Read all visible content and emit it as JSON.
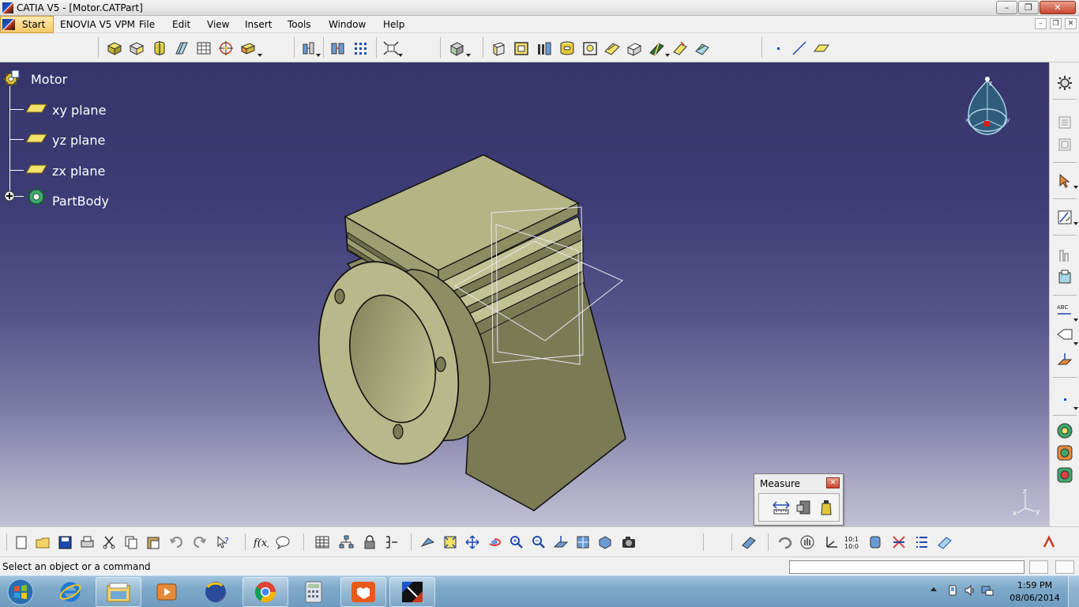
{
  "window": {
    "title": "CATIA V5 - [Motor.CATPart]",
    "controls": {
      "minimize": "–",
      "restore": "❒",
      "close": "✕"
    }
  },
  "menubar": {
    "start": "Start",
    "items": [
      "ENOVIA V5 VPM",
      "File",
      "Edit",
      "View",
      "Insert",
      "Tools",
      "Window",
      "Help"
    ],
    "mdi_controls": [
      "–",
      "❒",
      "✕"
    ]
  },
  "tree": {
    "root": "Motor",
    "children": [
      "xy plane",
      "yz plane",
      "zx plane",
      "PartBody"
    ]
  },
  "measure_window": {
    "title": "Measure",
    "tools": [
      "measure-between-icon",
      "measure-item-icon",
      "measure-inertia-icon"
    ]
  },
  "compass_axes": {
    "z": "z",
    "x": "x",
    "y": "y"
  },
  "statusbar": {
    "text": "Select an object or a command",
    "command_input": ""
  },
  "taskbar": {
    "time": "1:59 PM",
    "date": "08/06/2014"
  },
  "colors": {
    "viewport_top": "#36346a",
    "viewport_bottom": "#c1c0d4",
    "part_face": "#b8b98a",
    "part_side": "#7c7d58",
    "tree_text": "#ffffff"
  },
  "toolbars": {
    "top": [
      "pad-icon",
      "pocket-icon",
      "shaft-icon",
      "groove-icon",
      "hole-icon",
      "rib-icon",
      "slot-icon",
      "fillet-icon",
      "chamfer-icon",
      "draft-icon",
      "shell-icon",
      "thickness-icon",
      "translate-icon",
      "mirror-icon",
      "pattern-icon",
      "scale-icon",
      "boolean-icon",
      "sketcher-icon",
      "point-icon",
      "line-icon",
      "plane-icon"
    ],
    "right": [
      "settings-icon",
      "select-icon",
      "sketch-icon",
      "annotation-icon",
      "constraint-icon",
      "analysis-icon"
    ],
    "bottom": [
      "new-icon",
      "open-icon",
      "save-icon",
      "print-icon",
      "cut-icon",
      "copy-icon",
      "paste-icon",
      "undo-icon",
      "redo-icon",
      "help-icon",
      "formula-icon",
      "comment-icon",
      "table-icon",
      "tree-icon",
      "lock-icon",
      "graph-icon",
      "fly-icon",
      "fit-all-icon",
      "pan-icon",
      "rotate-icon",
      "zoom-in-icon",
      "zoom-out-icon",
      "normal-view-icon",
      "iso-view-icon",
      "shading-icon",
      "camera-icon",
      "measure-icon"
    ]
  }
}
